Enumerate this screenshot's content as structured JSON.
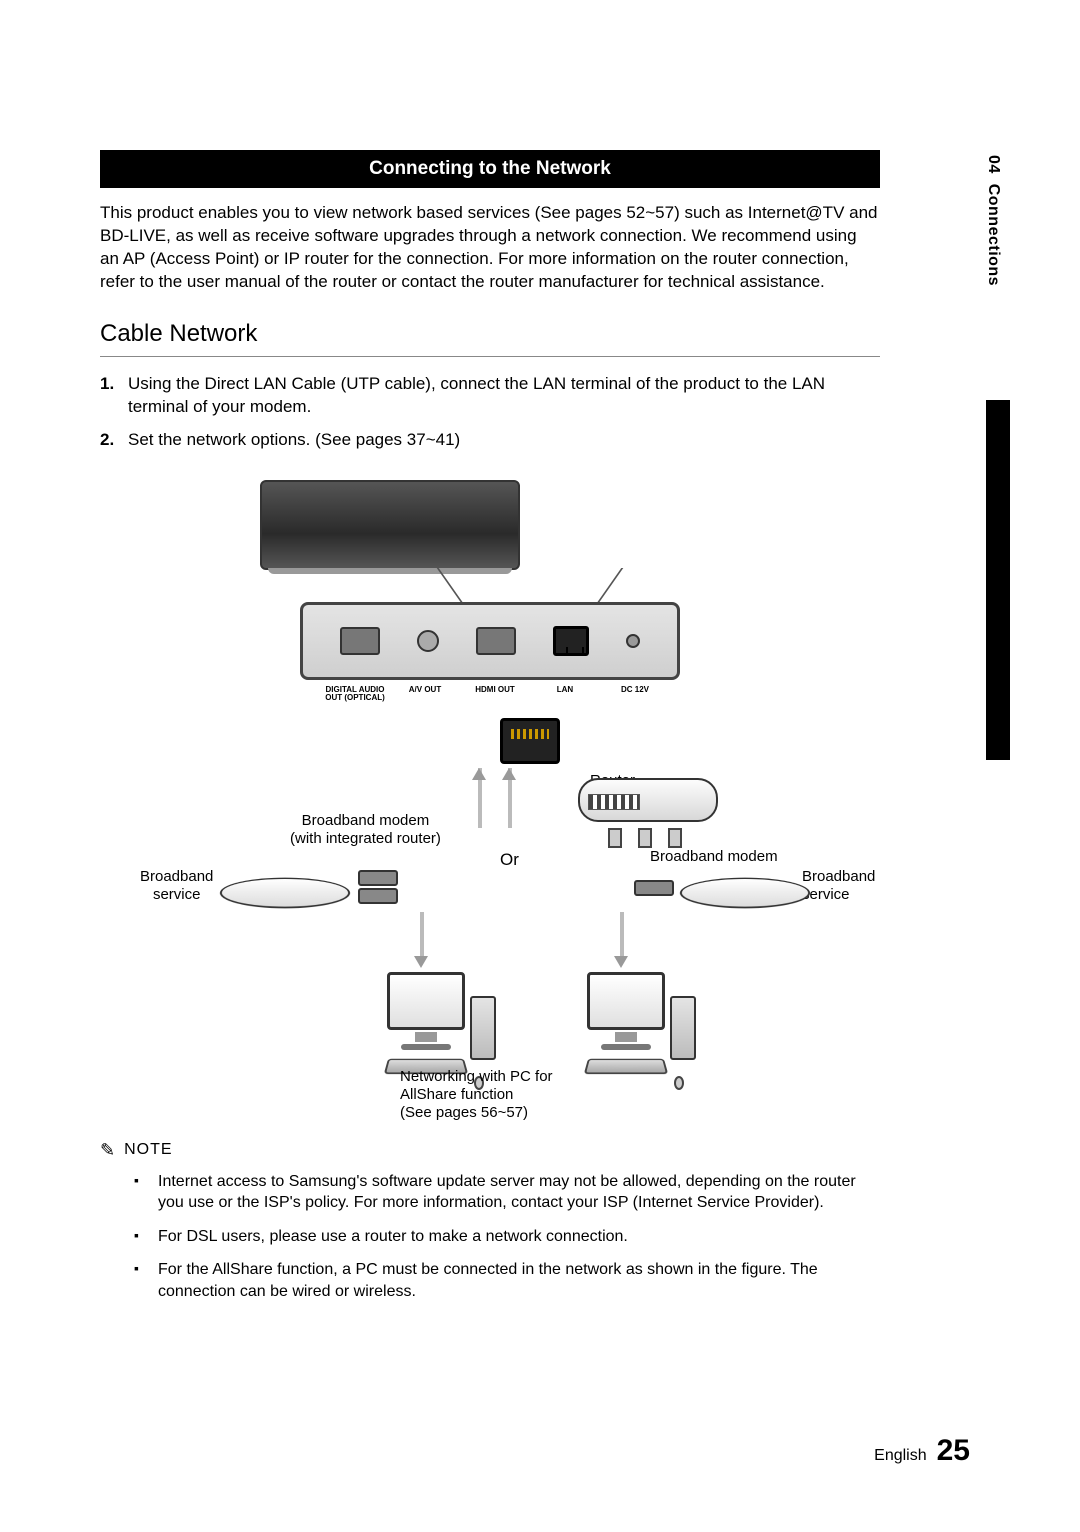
{
  "sidebar": {
    "chapter": "04",
    "title": "Connections"
  },
  "header": {
    "title": "Connecting to the Network"
  },
  "intro": "This product enables you to view network based services (See pages 52~57) such as Internet@TV and BD-LIVE, as well as receive software upgrades through a network connection. We recommend using an AP (Access Point) or IP router for the connection. For more information on the router connection, refer to the user manual of the router or contact the router manufacturer for technical assistance.",
  "section_title": "Cable Network",
  "steps": [
    {
      "num": "1.",
      "text": "Using the Direct LAN Cable (UTP cable), connect the LAN terminal of the product to the LAN terminal of your modem."
    },
    {
      "num": "2.",
      "text": "Set the network options. (See pages 37~41)"
    }
  ],
  "ports": {
    "digital_audio": "DIGITAL AUDIO\nOUT (OPTICAL)",
    "av_out": "A/V OUT",
    "hdmi_out": "HDMI OUT",
    "lan": "LAN",
    "dc12v": "DC 12V"
  },
  "diagram": {
    "router": "Router",
    "modem_integrated": "Broadband modem\n(with integrated router)",
    "modem": "Broadband modem",
    "service_l": "Broadband\nservice",
    "service_r": "Broadband\nservice",
    "or": "Or",
    "pc_note": "Networking with PC for\nAllShare function\n(See pages 56~57)"
  },
  "note": {
    "label": "NOTE",
    "items": [
      "Internet access to Samsung's software update server may not be allowed, depending on the router you use or the ISP's policy. For more information, contact your ISP (Internet Service Provider).",
      "For DSL users, please use a router to make a network connection.",
      "For the AllShare function, a PC must be connected in the network as shown in the figure. The connection can be wired or wireless."
    ]
  },
  "footer": {
    "lang": "English",
    "page": "25"
  }
}
